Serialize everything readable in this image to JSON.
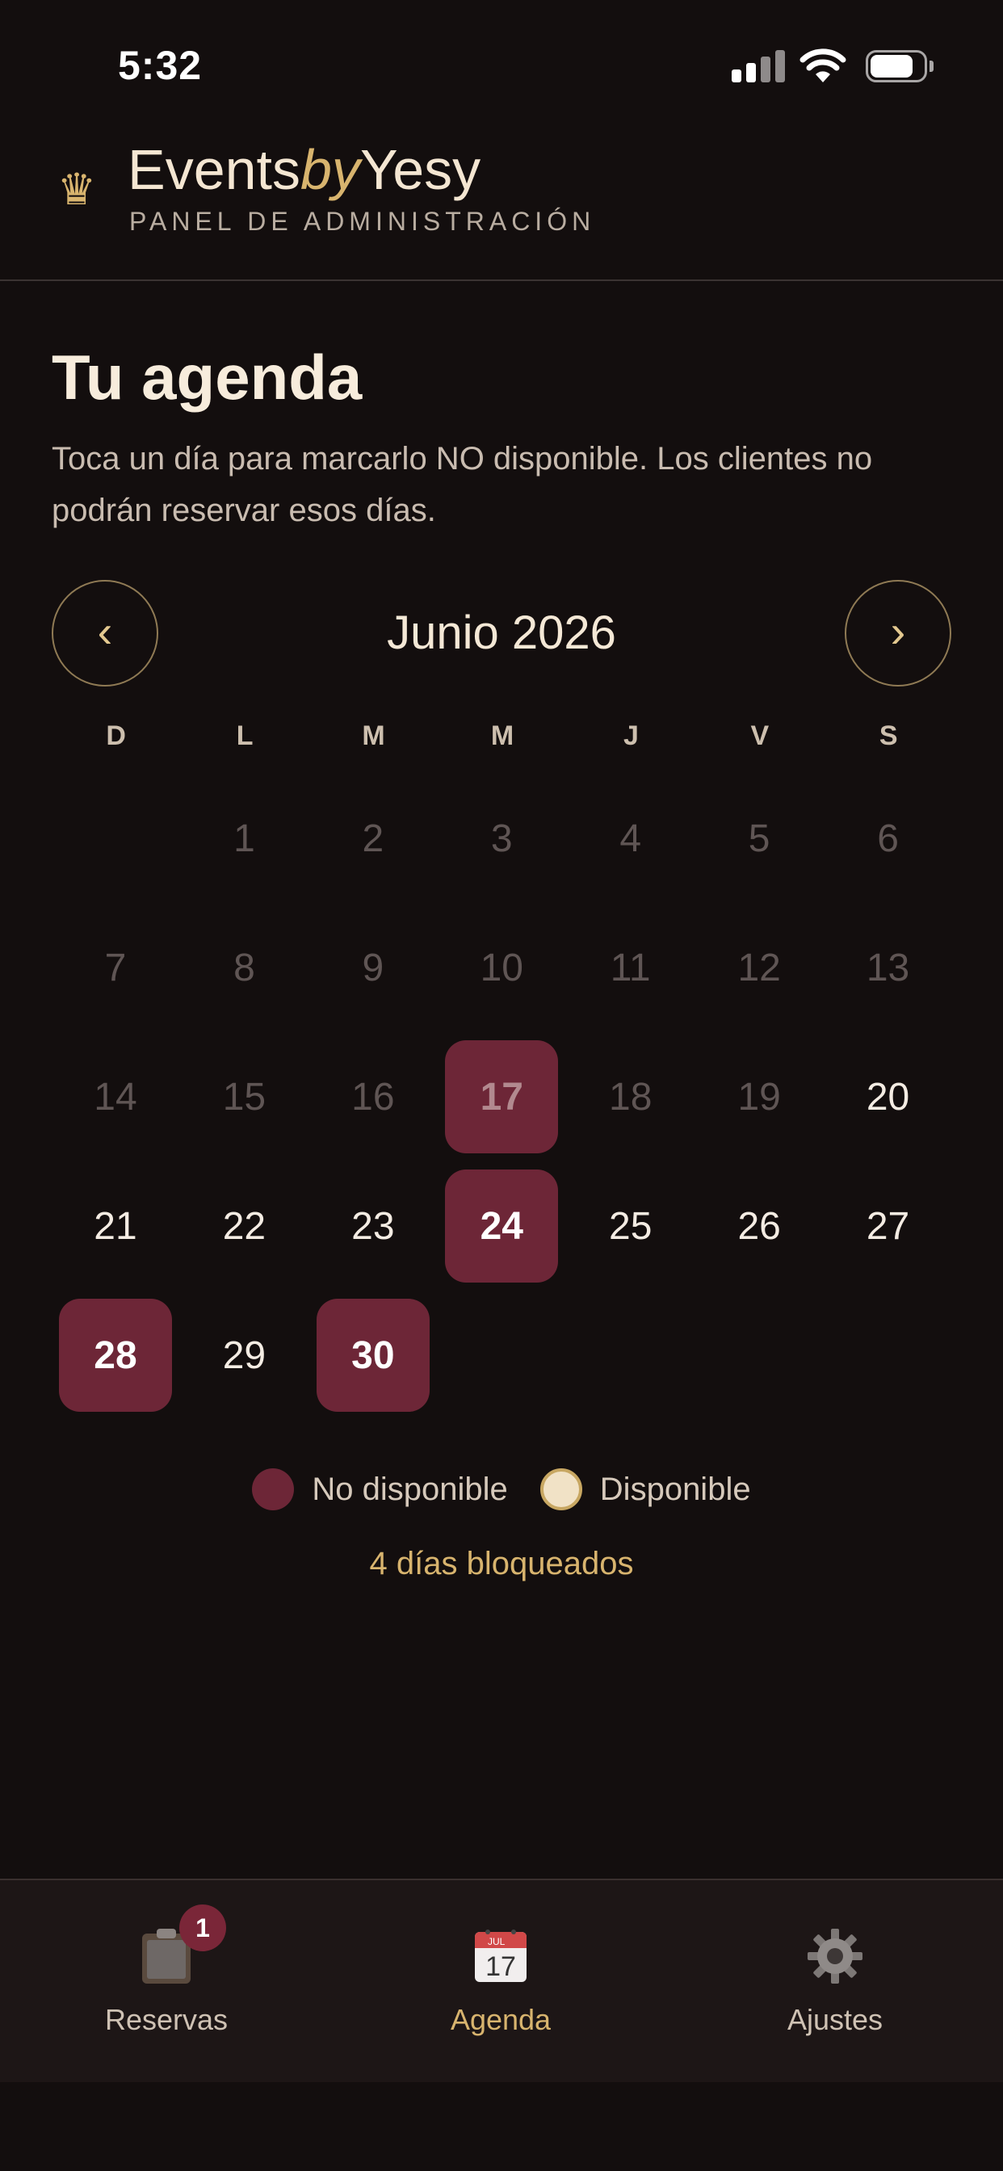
{
  "status_bar": {
    "time": "5:32"
  },
  "header": {
    "brand_part1": "Events",
    "brand_part2": "by",
    "brand_part3": "Yesy",
    "subtitle": "PANEL DE ADMINISTRACIÓN",
    "icon": "crown-icon"
  },
  "agenda": {
    "title": "Tu agenda",
    "description": "Toca un día para marcarlo NO disponible. Los clientes no podrán reservar esos días.",
    "prev_label": "‹",
    "next_label": "›",
    "month_label": "Junio 2026",
    "weekdays": [
      "D",
      "L",
      "M",
      "M",
      "J",
      "V",
      "S"
    ],
    "first_weekday_offset": 1,
    "days_in_month": 30,
    "past_days": [
      1,
      2,
      3,
      4,
      5,
      6,
      7,
      8,
      9,
      10,
      11,
      12,
      13,
      14,
      15,
      16,
      17,
      18,
      19
    ],
    "blocked_days": [
      17,
      24,
      28,
      30
    ]
  },
  "legend": {
    "unavailable_label": "No disponible",
    "available_label": "Disponible",
    "blocked_count_text": "4 días bloqueados"
  },
  "tabbar": {
    "reservas_label": "Reservas",
    "reservas_badge": "1",
    "agenda_label": "Agenda",
    "agenda_icon_month": "JUL",
    "agenda_icon_day": "17",
    "ajustes_label": "Ajustes",
    "active_tab": "agenda"
  },
  "colors": {
    "background": "#130e0e",
    "accent_gold": "#d8b46e",
    "blocked": "#6d2637"
  }
}
